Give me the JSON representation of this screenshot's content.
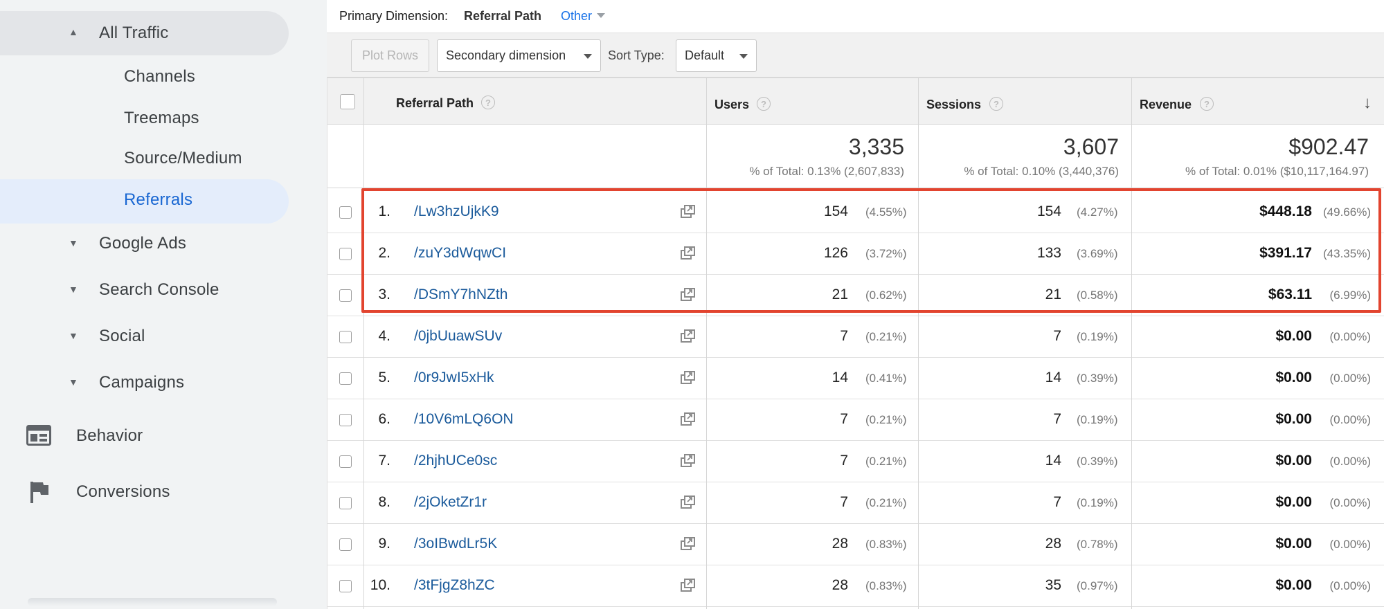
{
  "sidebar": {
    "all_traffic": "All Traffic",
    "sub_items": [
      "Channels",
      "Treemaps",
      "Source/Medium",
      "Referrals"
    ],
    "groups": [
      "Google Ads",
      "Search Console",
      "Social",
      "Campaigns"
    ],
    "behavior": "Behavior",
    "conversions": "Conversions"
  },
  "primary": {
    "label": "Primary Dimension:",
    "value": "Referral Path",
    "other": "Other"
  },
  "toolbar": {
    "plot_rows": "Plot Rows",
    "secondary": "Secondary dimension",
    "sort_label": "Sort Type:",
    "sort_value": "Default"
  },
  "table": {
    "headers": {
      "path": "Referral Path",
      "users": "Users",
      "sessions": "Sessions",
      "revenue": "Revenue"
    },
    "totals": {
      "users": "3,335",
      "users_pct": "% of Total: 0.13% (2,607,833)",
      "sessions": "3,607",
      "sessions_pct": "% of Total: 0.10% (3,440,376)",
      "revenue": "$902.47",
      "revenue_pct": "% of Total: 0.01% ($10,117,164.97)"
    },
    "rows": [
      {
        "idx": "1.",
        "path": "/Lw3hzUjkK9",
        "users": "154",
        "users_pct": "(4.55%)",
        "sessions": "154",
        "sessions_pct": "(4.27%)",
        "revenue": "$448.18",
        "revenue_pct": "(49.66%)"
      },
      {
        "idx": "2.",
        "path": "/zuY3dWqwCI",
        "users": "126",
        "users_pct": "(3.72%)",
        "sessions": "133",
        "sessions_pct": "(3.69%)",
        "revenue": "$391.17",
        "revenue_pct": "(43.35%)"
      },
      {
        "idx": "3.",
        "path": "/DSmY7hNZth",
        "users": "21",
        "users_pct": "(0.62%)",
        "sessions": "21",
        "sessions_pct": "(0.58%)",
        "revenue": "$63.11",
        "revenue_pct": "(6.99%)"
      },
      {
        "idx": "4.",
        "path": "/0jbUuawSUv",
        "users": "7",
        "users_pct": "(0.21%)",
        "sessions": "7",
        "sessions_pct": "(0.19%)",
        "revenue": "$0.00",
        "revenue_pct": "(0.00%)"
      },
      {
        "idx": "5.",
        "path": "/0r9JwI5xHk",
        "users": "14",
        "users_pct": "(0.41%)",
        "sessions": "14",
        "sessions_pct": "(0.39%)",
        "revenue": "$0.00",
        "revenue_pct": "(0.00%)"
      },
      {
        "idx": "6.",
        "path": "/10V6mLQ6ON",
        "users": "7",
        "users_pct": "(0.21%)",
        "sessions": "7",
        "sessions_pct": "(0.19%)",
        "revenue": "$0.00",
        "revenue_pct": "(0.00%)"
      },
      {
        "idx": "7.",
        "path": "/2hjhUCe0sc",
        "users": "7",
        "users_pct": "(0.21%)",
        "sessions": "14",
        "sessions_pct": "(0.39%)",
        "revenue": "$0.00",
        "revenue_pct": "(0.00%)"
      },
      {
        "idx": "8.",
        "path": "/2jOketZr1r",
        "users": "7",
        "users_pct": "(0.21%)",
        "sessions": "7",
        "sessions_pct": "(0.19%)",
        "revenue": "$0.00",
        "revenue_pct": "(0.00%)"
      },
      {
        "idx": "9.",
        "path": "/3oIBwdLr5K",
        "users": "28",
        "users_pct": "(0.83%)",
        "sessions": "28",
        "sessions_pct": "(0.78%)",
        "revenue": "$0.00",
        "revenue_pct": "(0.00%)"
      },
      {
        "idx": "10.",
        "path": "/3tFjgZ8hZC",
        "users": "28",
        "users_pct": "(0.83%)",
        "sessions": "35",
        "sessions_pct": "(0.97%)",
        "revenue": "$0.00",
        "revenue_pct": "(0.00%)"
      }
    ]
  },
  "colors": {
    "highlight": "#e2442f",
    "link": "#1a5a9b",
    "active_nav": "#1967d2"
  }
}
